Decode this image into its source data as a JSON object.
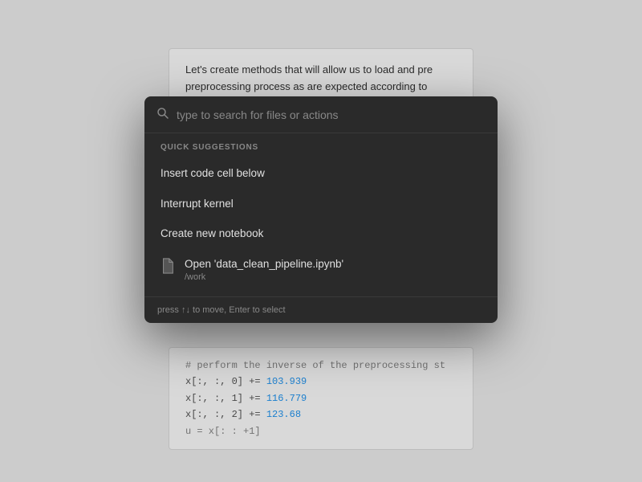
{
  "notebook": {
    "cell_top_text": "Let's create methods that will allow us to load and pre preprocessing process as are expected according to",
    "cell_bottom_lines": [
      {
        "text": "# perform the inverse of the preprocessing st",
        "color": "comment"
      },
      {
        "text": "x[:, :, 0] += 103.939",
        "color": "mixed"
      },
      {
        "text": "x[:, :, 1] += 116.779",
        "color": "mixed"
      },
      {
        "text": "x[:, :, 2] += 123.68",
        "color": "mixed"
      },
      {
        "text": "u = x[: : +1]",
        "color": "plain"
      }
    ]
  },
  "command_palette": {
    "search_placeholder": "type to search for files or actions",
    "section_label": "QUICK SUGGESTIONS",
    "suggestions": [
      {
        "id": "insert-code",
        "label": "Insert code cell below",
        "icon": false,
        "subtext": ""
      },
      {
        "id": "interrupt-kernel",
        "label": "Interrupt kernel",
        "icon": false,
        "subtext": ""
      },
      {
        "id": "create-notebook",
        "label": "Create new notebook",
        "icon": false,
        "subtext": ""
      },
      {
        "id": "open-file",
        "label": "Open 'data_clean_pipeline.ipynb'",
        "icon": true,
        "subtext": "/work"
      }
    ],
    "footer": "press ↑↓ to move, Enter to select"
  }
}
